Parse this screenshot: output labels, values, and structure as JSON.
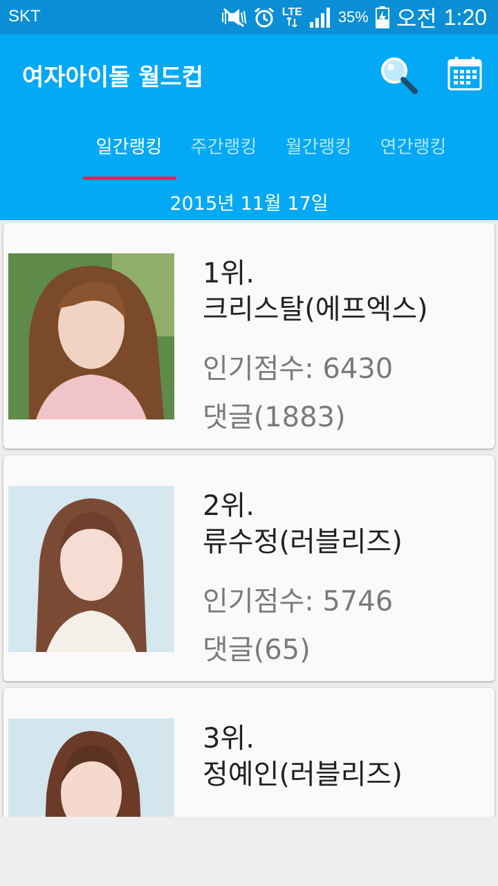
{
  "status_bar": {
    "carrier": "SKT",
    "network": "LTE",
    "battery": "35%",
    "ampm": "오전",
    "time": "1:20",
    "icons": [
      "mute-icon",
      "alarm-icon",
      "lte-icon",
      "signal-icon",
      "battery-icon"
    ]
  },
  "app_bar": {
    "title": "여자아이돌 월드컵",
    "icons": [
      "search-icon",
      "calendar-icon"
    ],
    "color": "#03a9f4",
    "indicator_color": "#e91e63"
  },
  "tabs": [
    {
      "label": "일간랭킹",
      "active": true
    },
    {
      "label": "주간랭킹",
      "active": false
    },
    {
      "label": "월간랭킹",
      "active": false
    },
    {
      "label": "연간랭킹",
      "active": false
    }
  ],
  "date": "2015년 11월 17일",
  "rankings": [
    {
      "rank": "1위.",
      "name": "크리스탈(에프엑스)",
      "score": "인기점수: 6430",
      "comments": "댓글(1883)"
    },
    {
      "rank": "2위.",
      "name": "류수정(러블리즈)",
      "score": "인기점수: 5746",
      "comments": "댓글(65)"
    },
    {
      "rank": "3위.",
      "name": "정예인(러블리즈)",
      "score": "",
      "comments": ""
    }
  ]
}
